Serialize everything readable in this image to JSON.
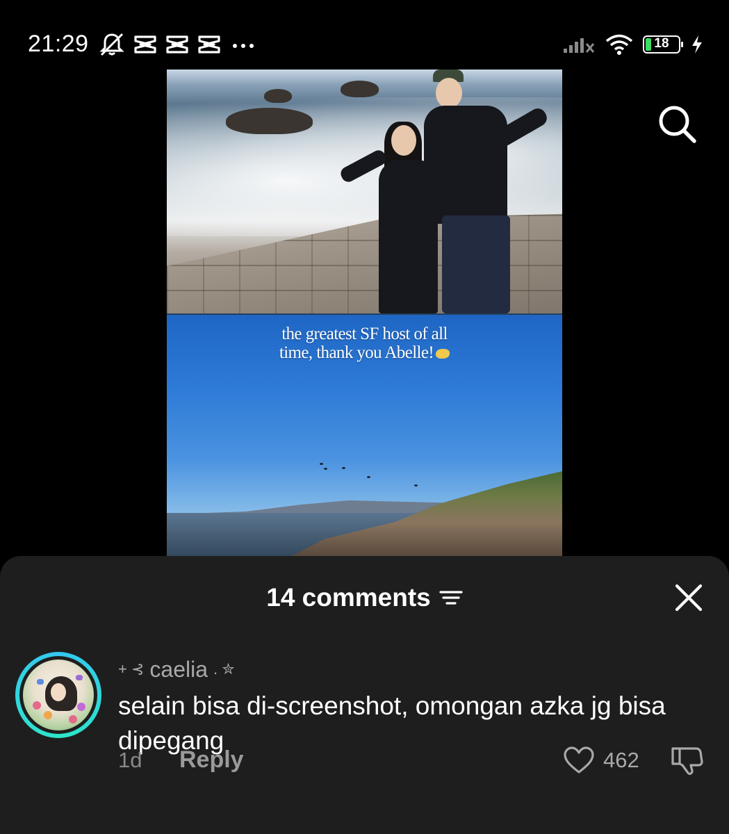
{
  "status_bar": {
    "time": "21:29",
    "battery_level": "18",
    "icons": [
      "mute-icon",
      "capcut-icon",
      "capcut-icon",
      "capcut-icon",
      "more-dots-icon",
      "signal-icon",
      "wifi-icon",
      "battery-icon",
      "charging-icon"
    ]
  },
  "media": {
    "caption_line1": "the greatest SF host of all",
    "caption_line2": "time, thank you Abelle!"
  },
  "header": {
    "search_icon": "search-icon"
  },
  "comments_sheet": {
    "title": "14 comments",
    "sort_icon": "sort-icon",
    "close_icon": "close-icon",
    "comment": {
      "username": "caelia",
      "username_prefix": "+ ⊰",
      "username_suffix": ". ✮",
      "text": "selain bisa di-screenshot, omongan azka jg bisa dipegang",
      "time": "1d",
      "reply_label": "Reply",
      "like_count": "462"
    }
  },
  "colors": {
    "sheet_background": "#1e1e1e",
    "avatar_ring": "#33c6f0",
    "battery_fill": "#3ddc63"
  }
}
